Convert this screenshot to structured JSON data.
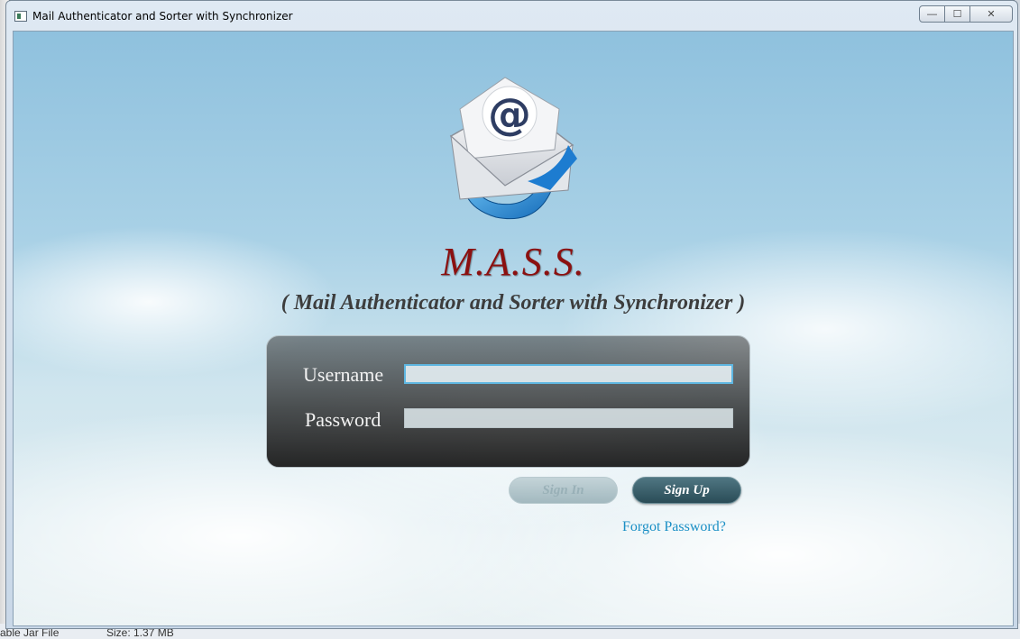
{
  "window": {
    "title": "Mail Authenticator and Sorter with Synchronizer",
    "controls": {
      "minimize": "—",
      "maximize": "☐",
      "close": "✕"
    }
  },
  "brand": {
    "name": "M.A.S.S.",
    "subtitle": "( Mail Authenticator and Sorter with Synchronizer )",
    "logo_icon": "email-envelope-at-icon"
  },
  "login": {
    "username_label": "Username",
    "password_label": "Password",
    "username_value": "",
    "password_value": ""
  },
  "actions": {
    "sign_in": "Sign In",
    "sign_up": "Sign Up",
    "forgot_password": "Forgot Password?"
  },
  "taskbar": {
    "file_type": "able Jar File",
    "size": "Size: 1.37 MB"
  },
  "colors": {
    "brand_name": "#8b1010",
    "subtitle": "#3d3d3d",
    "link": "#1a8fc5",
    "sign_up_bg": "#2f5360"
  }
}
